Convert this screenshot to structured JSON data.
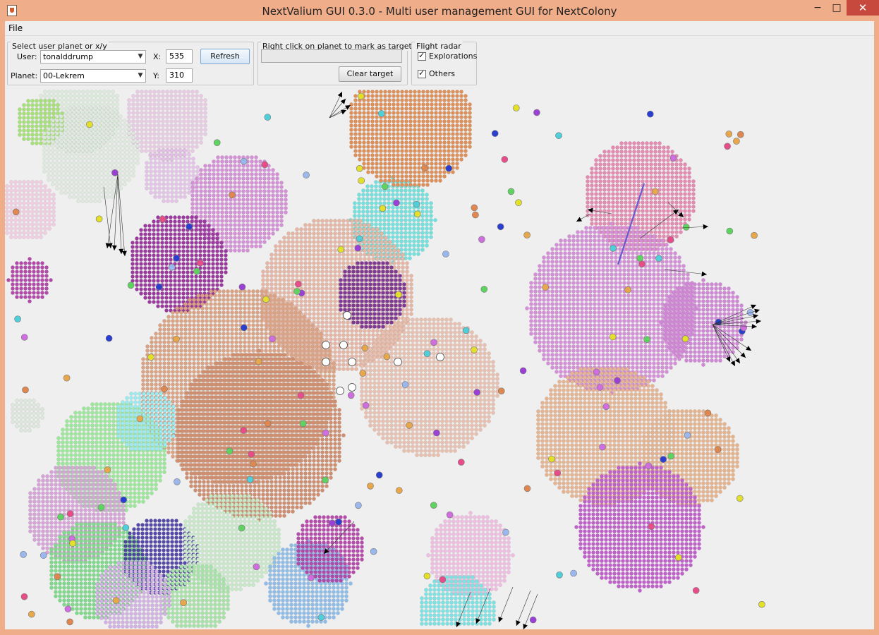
{
  "window": {
    "title": "NextValium GUI 0.3.0 - Multi user management GUI for NextColony",
    "controls": {
      "minimize": "−",
      "maximize": "□",
      "close": "✕"
    }
  },
  "menubar": {
    "file": "File"
  },
  "user_panel": {
    "title": "Select user planet or x/y",
    "user_label": "User:",
    "user_value": "tonalddrump",
    "planet_label": "Planet:",
    "planet_value": "00-Lekrem",
    "x_label": "X:",
    "x_value": "535",
    "y_label": "Y:",
    "y_value": "310",
    "refresh_label": "Refresh"
  },
  "target_panel": {
    "title": "Right click on planet to mark as target",
    "target_value": "",
    "clear_label": "Clear target"
  },
  "radar_panel": {
    "title": "Flight radar",
    "explorations_label": "Explorations",
    "explorations_checked": true,
    "others_label": "Others",
    "others_checked": true
  },
  "map": {
    "description_icon": "galaxy-map",
    "colors": {
      "background": "#efefef",
      "fleet_line": "#6a5acd",
      "arrow": "#000000",
      "own_planet": "#ffffff"
    }
  }
}
